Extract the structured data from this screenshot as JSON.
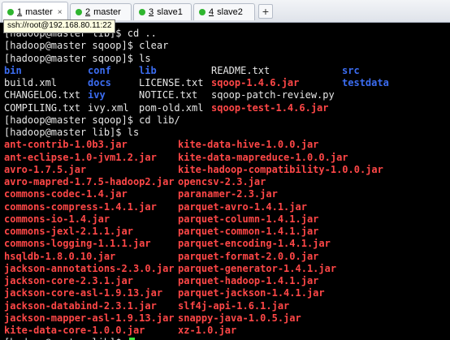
{
  "tooltip": "ssh://root@192.168.80.11:22",
  "tabs": [
    {
      "num": "1",
      "label": "master",
      "active": true,
      "closable": true
    },
    {
      "num": "2",
      "label": "master",
      "active": false,
      "closable": false
    },
    {
      "num": "3",
      "label": "slave1",
      "active": false,
      "closable": false
    },
    {
      "num": "4",
      "label": "slave2",
      "active": false,
      "closable": false
    }
  ],
  "add_tab_label": "+",
  "close_glyph": "×",
  "terminal": {
    "cmd_lines": [
      "[hadoop@master lib]$ cd ..",
      "[hadoop@master sqoop]$ clear",
      "[hadoop@master sqoop]$ ls"
    ],
    "ls_sqoop": [
      [
        "bin",
        "conf",
        "lib",
        "README.txt",
        "src"
      ],
      [
        "build.xml",
        "docs",
        "LICENSE.txt",
        "sqoop-1.4.6.jar",
        "testdata"
      ],
      [
        "CHANGELOG.txt",
        "ivy",
        "NOTICE.txt",
        "sqoop-patch-review.py",
        ""
      ],
      [
        "COMPILING.txt",
        "ivy.xml",
        "pom-old.xml",
        "sqoop-test-1.4.6.jar",
        ""
      ]
    ],
    "cmd_lines2": [
      "[hadoop@master sqoop]$ cd lib/",
      "[hadoop@master lib]$ ls"
    ],
    "ls_lib_left": [
      "ant-contrib-1.0b3.jar",
      "ant-eclipse-1.0-jvm1.2.jar",
      "avro-1.7.5.jar",
      "avro-mapred-1.7.5-hadoop2.jar",
      "commons-codec-1.4.jar",
      "commons-compress-1.4.1.jar",
      "commons-io-1.4.jar",
      "commons-jexl-2.1.1.jar",
      "commons-logging-1.1.1.jar",
      "hsqldb-1.8.0.10.jar",
      "jackson-annotations-2.3.0.jar",
      "jackson-core-2.3.1.jar",
      "jackson-core-asl-1.9.13.jar",
      "jackson-databind-2.3.1.jar",
      "jackson-mapper-asl-1.9.13.jar",
      "kite-data-core-1.0.0.jar"
    ],
    "ls_lib_right": [
      "kite-data-hive-1.0.0.jar",
      "kite-data-mapreduce-1.0.0.jar",
      "kite-hadoop-compatibility-1.0.0.jar",
      "opencsv-2.3.jar",
      "paranamer-2.3.jar",
      "parquet-avro-1.4.1.jar",
      "parquet-column-1.4.1.jar",
      "parquet-common-1.4.1.jar",
      "parquet-encoding-1.4.1.jar",
      "parquet-format-2.0.0.jar",
      "parquet-generator-1.4.1.jar",
      "parquet-hadoop-1.4.1.jar",
      "parquet-jackson-1.4.1.jar",
      "slf4j-api-1.6.1.jar",
      "snappy-java-1.0.5.jar",
      "xz-1.0.jar"
    ],
    "prompt": "[hadoop@master lib]$ "
  },
  "colors": {
    "background": "#000000",
    "text": "#e6e6e6",
    "directory": "#3b6cf0",
    "jar": "#ff4747",
    "cursor": "#3ce33c",
    "tab_dot": "#2fb52f"
  }
}
